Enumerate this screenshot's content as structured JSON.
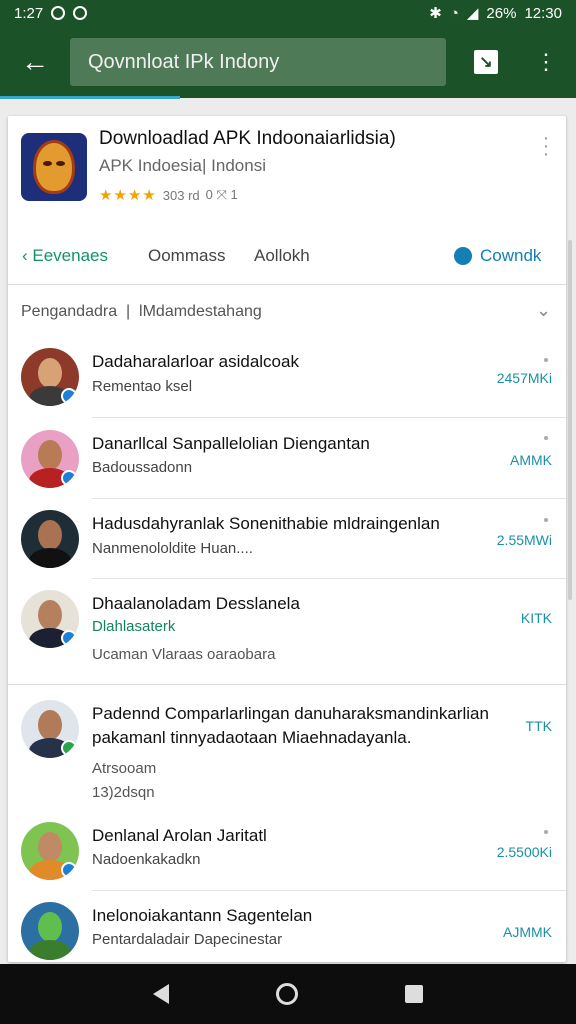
{
  "status": {
    "time_left": "1:27",
    "battery": "26%",
    "time_right": "12:30"
  },
  "appbar": {
    "search_text": "Qovnnloat IPk Indony",
    "back_icon": "arrow-left-icon",
    "share_icon": "share-icon",
    "more_icon": "more-vert-icon"
  },
  "app": {
    "title": "Downloadlad APK Indoonaiarlidsia)",
    "subtitle": "APK Indoesia| Indonsi",
    "rating_text": "303 rd",
    "rating_count": "0 ⤧ 1"
  },
  "tabs": [
    {
      "label": "Eevenaes",
      "icon": "back-arrow"
    },
    {
      "label": "Oommass"
    },
    {
      "label": "Aollokh"
    },
    {
      "label": "Cowndk"
    }
  ],
  "section": {
    "title": "Pengandadra",
    "subtitle": "lMdamdestahang"
  },
  "items": [
    {
      "name": "Dadaharalarloar asidalcoak",
      "sub": "Rementao ksel",
      "count": "2457MKi"
    },
    {
      "name": "Danarllcal Sanpallelolian Diengantan",
      "sub": "Badoussadonn",
      "count": "AMMK"
    },
    {
      "name": "Hadusdahyranlak Sonenithabie mldraingenlan",
      "sub": "Nanmenololdite Huan....",
      "count": "2.55MWi"
    },
    {
      "name": "Dhaalanoladam Desslanela",
      "sub": "Dlahlasaterk",
      "sub2": "Ucaman Vlaraas oaraobara",
      "count": "KITK"
    },
    {
      "name": "Padennd Comparlarlingan danuharaksmandinkarlian",
      "name2": "pakamanl tinnyadaotaan Miaehnadayanla.",
      "sub": "Atrsooam",
      "sub2": "13)2dsqn",
      "count": "TTK"
    },
    {
      "name": "Denlanal Arolan Jaritatl",
      "sub": "Nadoenkakadkn",
      "count": "2.5500Ki"
    },
    {
      "name": "Inelonoiakantann Sagentelan",
      "sub": "Pentardaladair Dapecinestar",
      "count": "AJMMK"
    }
  ],
  "colors": {
    "primary": "#1c5227",
    "accent": "#137fb3",
    "green_text": "#13855c"
  }
}
